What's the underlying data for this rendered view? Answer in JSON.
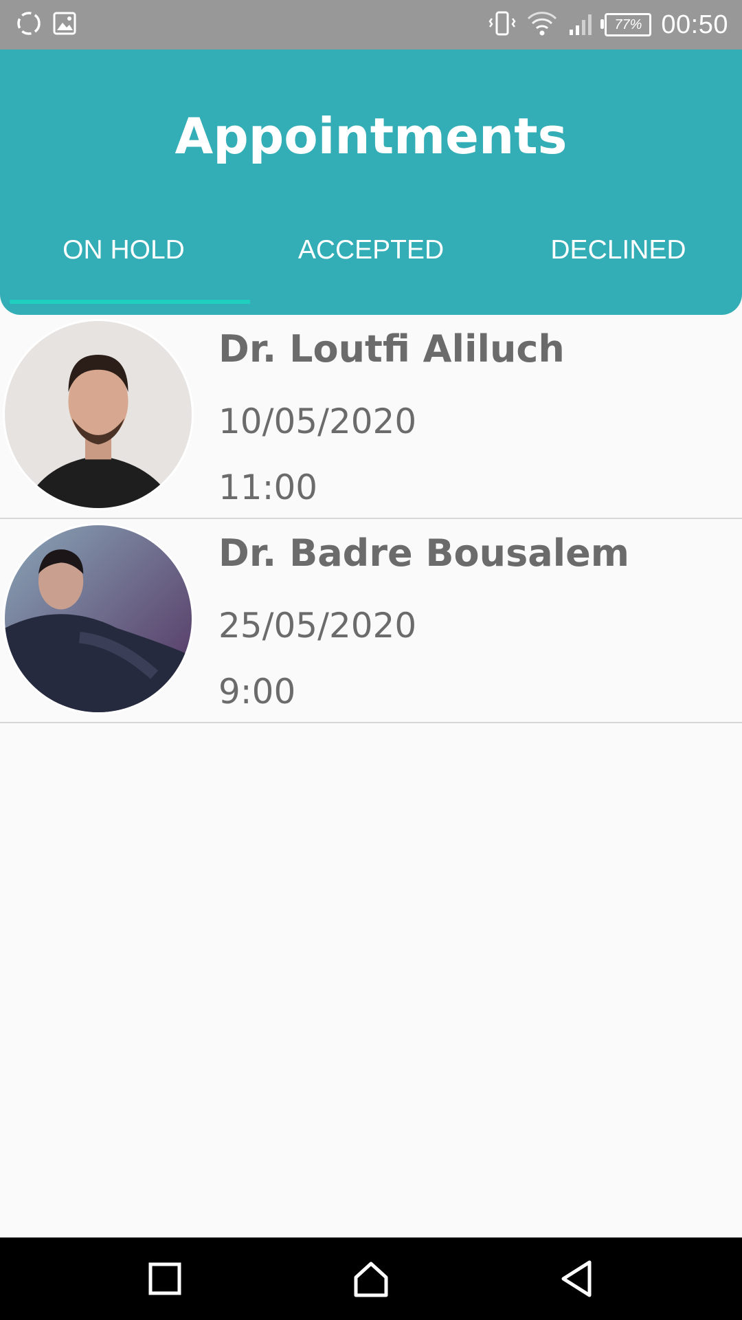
{
  "status_bar": {
    "time": "00:50",
    "battery_percent": "77%",
    "left_icons": [
      "sync-icon",
      "image-icon"
    ],
    "right_icons": [
      "vibrate-icon",
      "wifi-icon",
      "signal-icon",
      "battery-icon"
    ]
  },
  "header": {
    "title": "Appointments",
    "background_color": "#34aeb6",
    "tabs": [
      {
        "label": "ON HOLD",
        "selected": true
      },
      {
        "label": "ACCEPTED",
        "selected": false
      },
      {
        "label": "DECLINED",
        "selected": false
      }
    ],
    "indicator_color": "#1fd0c0"
  },
  "appointments": [
    {
      "doctor": "Dr. Loutfi Aliluch",
      "date": "10/05/2020",
      "time": "11:00"
    },
    {
      "doctor": "Dr. Badre Bousalem",
      "date": "25/05/2020",
      "time": "9:00"
    }
  ],
  "nav_bar": {
    "buttons": [
      "recents-icon",
      "home-icon",
      "back-icon"
    ]
  }
}
